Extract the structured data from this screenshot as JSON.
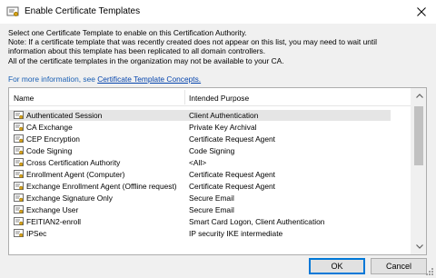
{
  "window": {
    "title": "Enable Certificate Templates",
    "title_icon": "certificate-icon",
    "close_icon": "close-icon"
  },
  "description": {
    "line1": "Select one Certificate Template to enable on this Certification Authority.",
    "line2": "Note: If a certificate template that was recently created does not appear on this list, you may need to wait until",
    "line3": "information about this template has been replicated to all domain controllers.",
    "line4": "All of the certificate templates in the organization may not be available to your CA.",
    "info_prefix": "For more information, see",
    "info_link": "Certificate Template Concepts."
  },
  "list": {
    "columns": [
      "Name",
      "Intended Purpose"
    ],
    "rows": [
      {
        "name": "Authenticated Session",
        "purpose": "Client Authentication",
        "selected": true
      },
      {
        "name": "CA Exchange",
        "purpose": "Private Key Archival"
      },
      {
        "name": "CEP Encryption",
        "purpose": "Certificate Request Agent"
      },
      {
        "name": "Code Signing",
        "purpose": "Code Signing"
      },
      {
        "name": "Cross Certification Authority",
        "purpose": "<All>"
      },
      {
        "name": "Enrollment Agent (Computer)",
        "purpose": "Certificate Request Agent"
      },
      {
        "name": "Exchange Enrollment Agent (Offline request)",
        "purpose": "Certificate Request Agent"
      },
      {
        "name": "Exchange Signature Only",
        "purpose": "Secure Email"
      },
      {
        "name": "Exchange User",
        "purpose": "Secure Email"
      },
      {
        "name": "FEITIAN2-enroll",
        "purpose": "Smart Card Logon, Client Authentication"
      },
      {
        "name": "IPSec",
        "purpose": "IP security IKE intermediate"
      }
    ],
    "row_icon": "certificate-template-icon",
    "scroll_icons": [
      "scroll-up-icon",
      "scroll-down-icon"
    ]
  },
  "buttons": {
    "ok": "OK",
    "cancel": "Cancel"
  },
  "colors": {
    "link": "#0645ad",
    "selection": "#e5e5e5",
    "ok_border": "#0078d7"
  }
}
